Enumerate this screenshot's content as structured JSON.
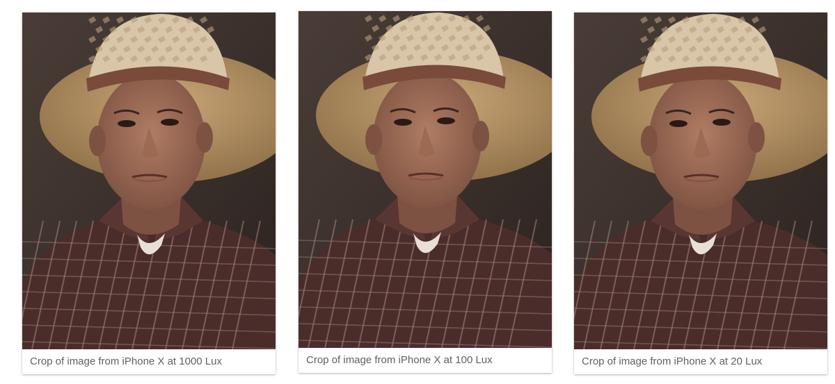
{
  "figures": [
    {
      "caption": "Crop of image from iPhone X at 1000 Lux",
      "photo_label": "portrait-photo-1000-lux"
    },
    {
      "caption": "Crop of image from iPhone X at 100 Lux",
      "photo_label": "portrait-photo-100-lux"
    },
    {
      "caption": "Crop of image from iPhone X at 20 Lux",
      "photo_label": "portrait-photo-20-lux"
    }
  ],
  "colors": {
    "background_dark": "#2b2320",
    "background_mid": "#4a3d37",
    "hat_light": "#d9c6a8",
    "hat_band": "#7a4a3a",
    "skin": "#b07c63",
    "skin_shadow": "#7d5242",
    "shirt": "#4a2d2a",
    "shirt_stripe": "#a7857c",
    "undershirt": "#e8e0d6",
    "caption_text": "#5f5f5f"
  }
}
